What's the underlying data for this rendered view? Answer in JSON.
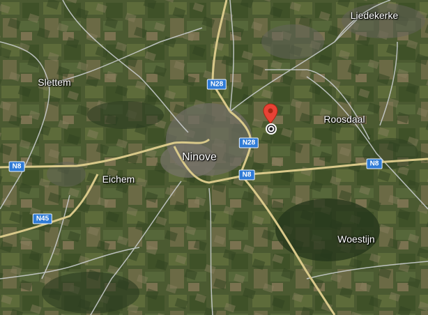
{
  "map": {
    "places": [
      {
        "id": "liedekerke",
        "label": "Liedekerke"
      },
      {
        "id": "slettem",
        "label": "Slettem"
      },
      {
        "id": "roosdaal",
        "label": "Roosdaal"
      },
      {
        "id": "ninove",
        "label": "Ninove"
      },
      {
        "id": "eichem",
        "label": "Eichem"
      },
      {
        "id": "woestijn",
        "label": "Woestijn"
      }
    ],
    "roads": [
      {
        "id": "n28-north",
        "label": "N28"
      },
      {
        "id": "n28-center",
        "label": "N28"
      },
      {
        "id": "n8-west",
        "label": "N8"
      },
      {
        "id": "n8-center",
        "label": "N8"
      },
      {
        "id": "n8-east",
        "label": "N8"
      },
      {
        "id": "n45",
        "label": "N45"
      }
    ],
    "road_colors": {
      "major": "#d9c98a",
      "minor": "#cfd3d6"
    },
    "pin_color": "#e94235",
    "shield_color": "#2f7bd6"
  }
}
